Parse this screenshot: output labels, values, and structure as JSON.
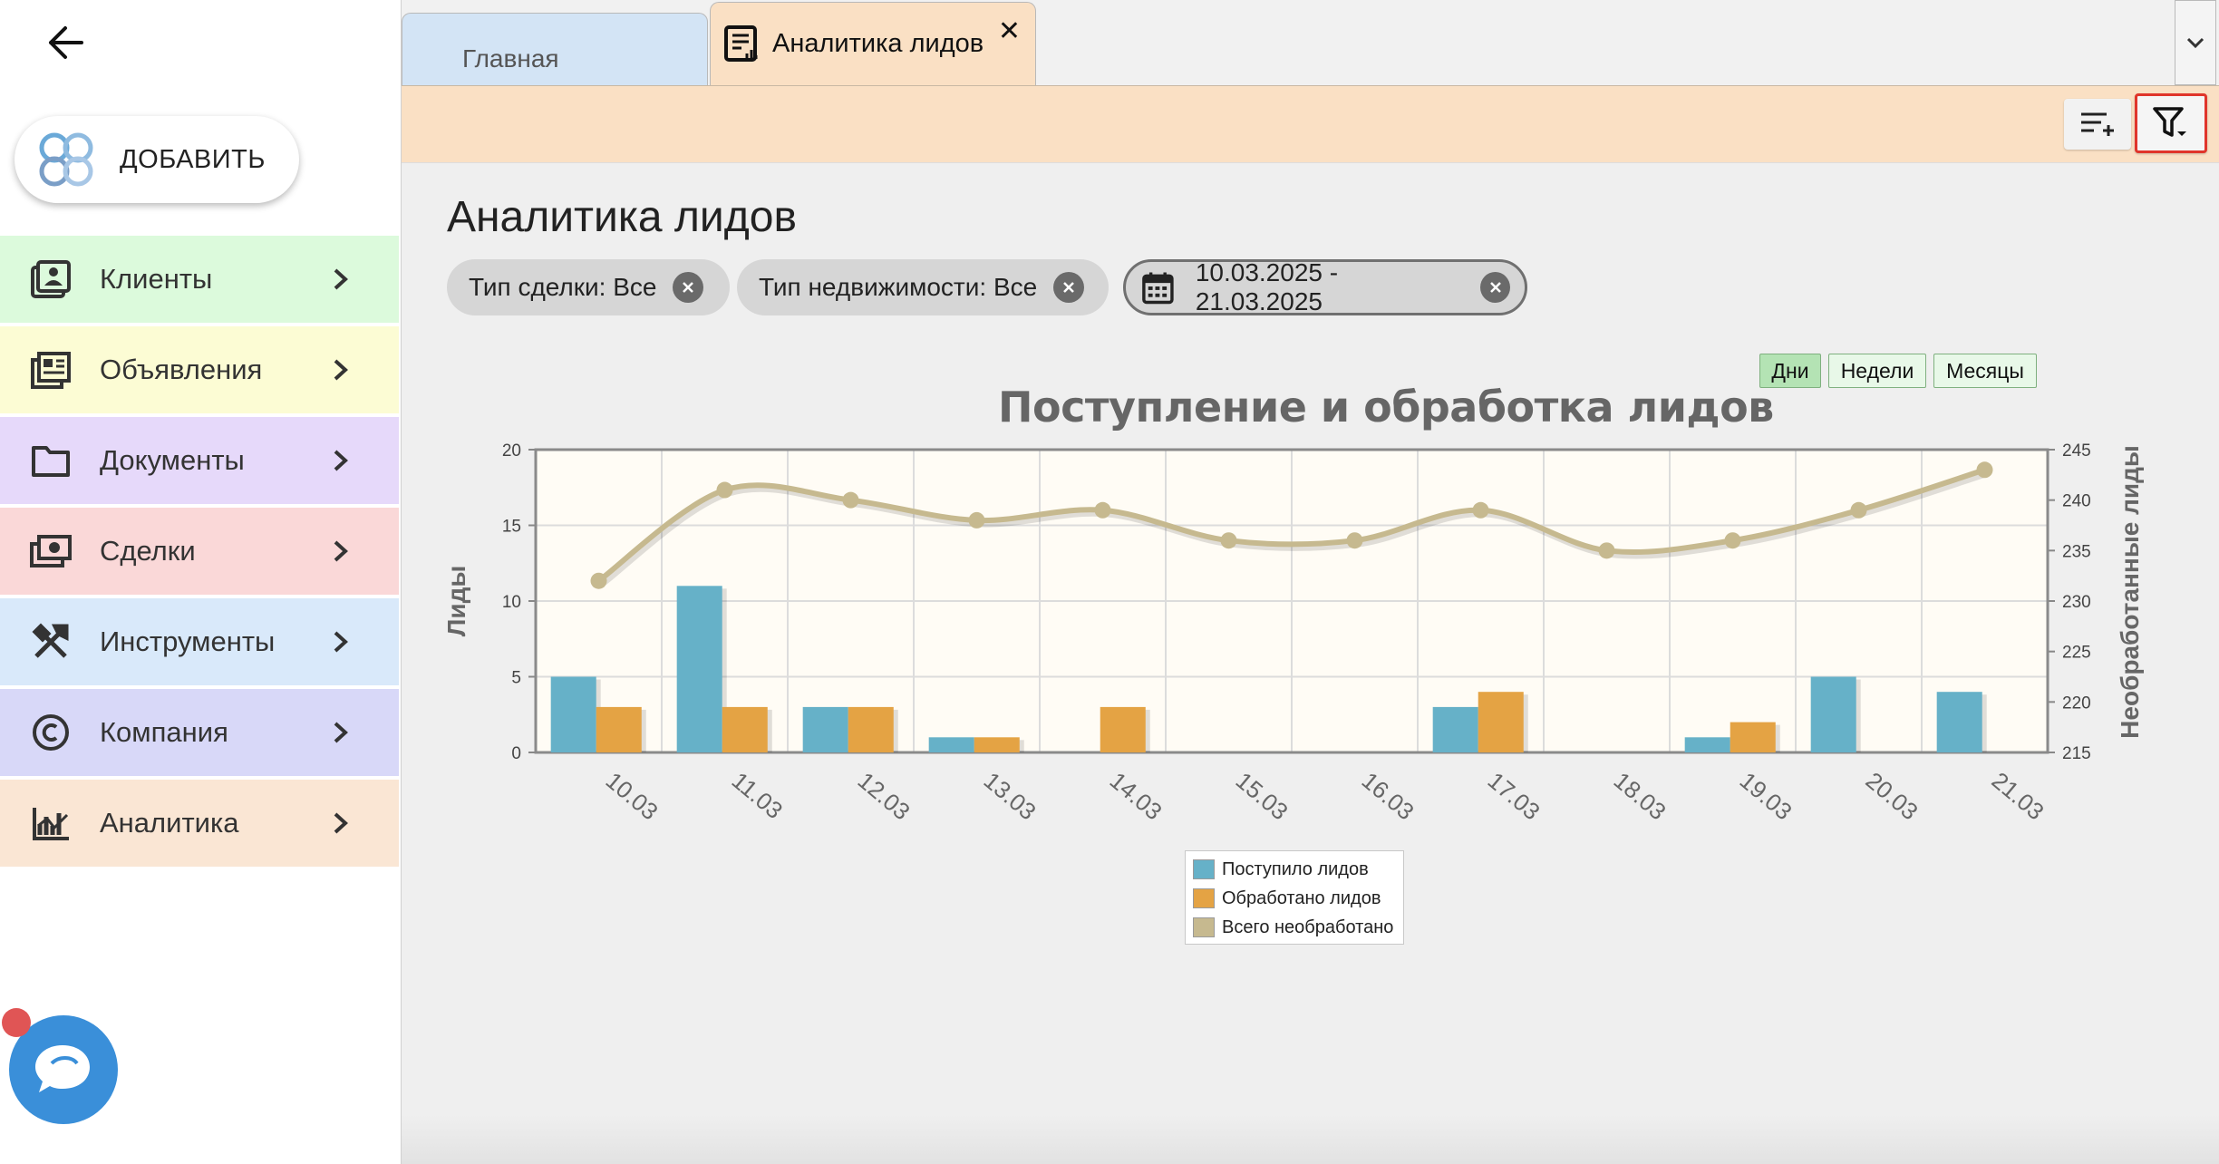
{
  "sidebar": {
    "add_label": "ДОБАВИТЬ",
    "items": [
      {
        "label": "Клиенты",
        "color": "#dcfadc",
        "icon": "contacts-icon"
      },
      {
        "label": "Объявления",
        "color": "#fcfcd4",
        "icon": "listings-icon"
      },
      {
        "label": "Документы",
        "color": "#e6d9fa",
        "icon": "folder-icon"
      },
      {
        "label": "Сделки",
        "color": "#fad8d8",
        "icon": "money-icon"
      },
      {
        "label": "Инструменты",
        "color": "#d9e9fa",
        "icon": "tools-icon"
      },
      {
        "label": "Компания",
        "color": "#d8d8f8",
        "icon": "copyright-icon"
      },
      {
        "label": "Аналитика",
        "color": "#fae6d4",
        "icon": "analytics-icon"
      }
    ]
  },
  "tabs": {
    "home": "Главная",
    "analytics": "Аналитика лидов",
    "close": "✕"
  },
  "page": {
    "title": "Аналитика лидов"
  },
  "filters": {
    "deal_type": "Тип сделки: Все",
    "property_type": "Тип недвижимости: Все",
    "date_range": "10.03.2025 - 21.03.2025"
  },
  "periods": {
    "days": "Дни",
    "weeks": "Недели",
    "months": "Месяцы"
  },
  "chart_data": {
    "type": "bar",
    "title": "Поступление и обработка лидов",
    "ylabel": "Лиды",
    "y2label": "Необработанные лиды",
    "ylim": [
      0,
      20
    ],
    "y2lim": [
      215,
      245
    ],
    "yticks": [
      "0",
      "5",
      "10",
      "15",
      "20"
    ],
    "y2ticks": [
      "215",
      "220",
      "225",
      "230",
      "235",
      "240",
      "245"
    ],
    "categories": [
      "10.03",
      "11.03",
      "12.03",
      "13.03",
      "14.03",
      "15.03",
      "16.03",
      "17.03",
      "18.03",
      "19.03",
      "20.03",
      "21.03"
    ],
    "series": [
      {
        "name": "Поступило лидов",
        "kind": "bar",
        "color": "#66b1c8",
        "values": [
          5,
          11,
          3,
          1,
          0,
          0,
          0,
          3,
          0,
          1,
          5,
          4
        ]
      },
      {
        "name": "Обработано лидов",
        "kind": "bar",
        "color": "#e4a344",
        "values": [
          3,
          3,
          3,
          1,
          3,
          0,
          0,
          4,
          0,
          2,
          0,
          0
        ]
      },
      {
        "name": "Всего необработано",
        "kind": "line",
        "axis": "right",
        "color": "#c6b98f",
        "values": [
          232,
          241,
          240,
          238,
          239,
          236,
          236,
          239,
          235,
          236,
          239,
          243
        ]
      }
    ],
    "grid": true,
    "legend": "bottom-center"
  }
}
